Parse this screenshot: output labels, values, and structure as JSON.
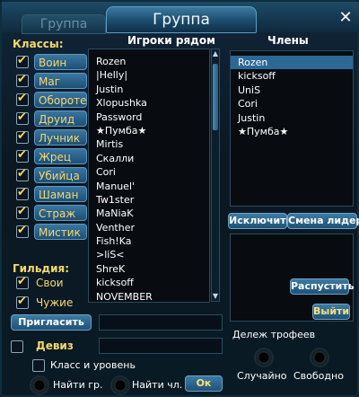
{
  "window": {
    "title": "Группа",
    "ghost_tab": "Группа",
    "close_glyph": "✕"
  },
  "classes": {
    "label": "Классы:",
    "items": [
      {
        "label": "Воин",
        "checked": true
      },
      {
        "label": "Маг",
        "checked": true
      },
      {
        "label": "Оборотень",
        "checked": true
      },
      {
        "label": "Друид",
        "checked": true
      },
      {
        "label": "Лучник",
        "checked": true
      },
      {
        "label": "Жрец",
        "checked": true
      },
      {
        "label": "Убийца",
        "checked": true
      },
      {
        "label": "Шаман",
        "checked": true
      },
      {
        "label": "Страж",
        "checked": true
      },
      {
        "label": "Мистик",
        "checked": true
      }
    ]
  },
  "guild": {
    "label": "Гильдия:",
    "items": [
      {
        "label": "Свои",
        "checked": true
      },
      {
        "label": "Чужие",
        "checked": true
      }
    ]
  },
  "nearby": {
    "header": "Игроки рядом",
    "players": [
      "Rozen",
      "|Helly|",
      "Justin",
      "Xlopushka",
      "Password",
      "★Пумба★",
      "Mirtis",
      "Скалли",
      "Cori",
      "Manuel'",
      "Tw1ster",
      "MaNiaK",
      "Venther",
      "Fish!Ka",
      ">liS<",
      "ShreK",
      "kicksoff",
      "NOVEMBER"
    ]
  },
  "members": {
    "header": "Члены",
    "list": [
      "Rozen",
      "kicksoff",
      "UniS",
      "Cori",
      "Justin",
      "★Пумба★"
    ],
    "selected_index": 0
  },
  "buttons": {
    "kick": "Исключить",
    "change_leader": "Смена лидера",
    "disband": "Распустить",
    "leave": "Выйти",
    "invite": "Пригласить",
    "ok": "Ок"
  },
  "motto": {
    "label": "Девиз",
    "checked": false
  },
  "class_level": {
    "label": "Класс и уровень",
    "checked": false
  },
  "find_group": {
    "label": "Найти гр."
  },
  "find_member": {
    "label": "Найти чл."
  },
  "loot": {
    "label": "Дележ трофеев",
    "options": [
      "Случайно",
      "Свободно"
    ]
  },
  "colors": {
    "accent_gold": "#f5d86c",
    "button_blue": "#2b6690",
    "selection": "#2c6896"
  }
}
